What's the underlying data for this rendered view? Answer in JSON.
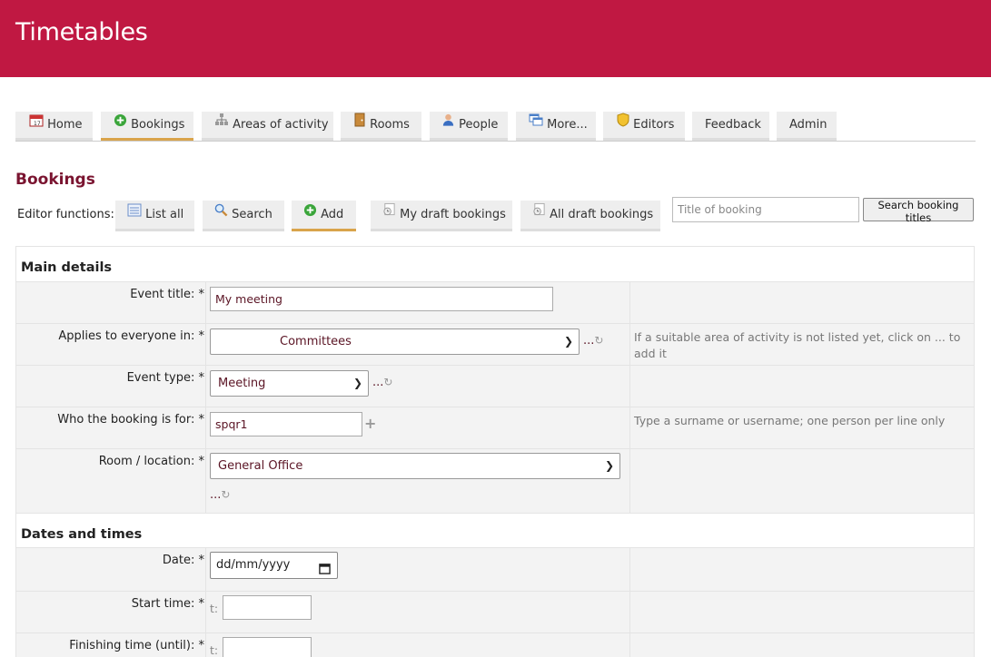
{
  "app": {
    "title": "Timetables"
  },
  "nav": {
    "tabs": [
      {
        "label": "Home",
        "icon": "calendar-icon"
      },
      {
        "label": "Bookings",
        "icon": "add-circle-icon",
        "active": true
      },
      {
        "label": "Areas of activity",
        "icon": "hierarchy-icon"
      },
      {
        "label": "Rooms",
        "icon": "door-icon"
      },
      {
        "label": "People",
        "icon": "person-icon"
      },
      {
        "label": "More...",
        "icon": "windows-icon"
      },
      {
        "label": "Editors",
        "icon": "shield-icon"
      },
      {
        "label": "Feedback"
      },
      {
        "label": "Admin"
      }
    ]
  },
  "page": {
    "title": "Bookings"
  },
  "editor": {
    "label": "Editor functions:",
    "tabs": [
      {
        "label": "List all",
        "icon": "list-icon"
      },
      {
        "label": "Search",
        "icon": "magnifier-icon"
      },
      {
        "label": "Add",
        "icon": "add-circle-icon",
        "active": true
      },
      {
        "label": "My draft bookings",
        "icon": "draft-icon"
      },
      {
        "label": "All draft bookings",
        "icon": "draft-icon"
      }
    ],
    "search_placeholder": "Title of booking",
    "search_button": "Search booking titles"
  },
  "form": {
    "main_heading": "Main details",
    "dates_heading": "Dates and times",
    "dots": "...",
    "event_title": {
      "label": "Event title: *",
      "value": "My meeting"
    },
    "applies_to": {
      "label": "Applies to everyone in: *",
      "value": "Committees",
      "help": "If a suitable area of activity is not listed yet, click on ... to add it"
    },
    "event_type": {
      "label": "Event type: *",
      "value": "Meeting"
    },
    "who_for": {
      "label": "Who the booking is for: *",
      "value": "spqr1",
      "help": "Type a surname or username; one person per line only"
    },
    "room": {
      "label": "Room / location: *",
      "value": "General Office"
    },
    "date": {
      "label": "Date: *",
      "placeholder": "dd/mm/yyyy"
    },
    "start_time": {
      "label": "Start time: *",
      "prefix": "t:"
    },
    "finish_time": {
      "label": "Finishing time (until): *",
      "prefix": "t:"
    }
  },
  "colors": {
    "banner": "#c01842",
    "title": "#7a1430",
    "active_tab_underline": "#d9a44b"
  }
}
